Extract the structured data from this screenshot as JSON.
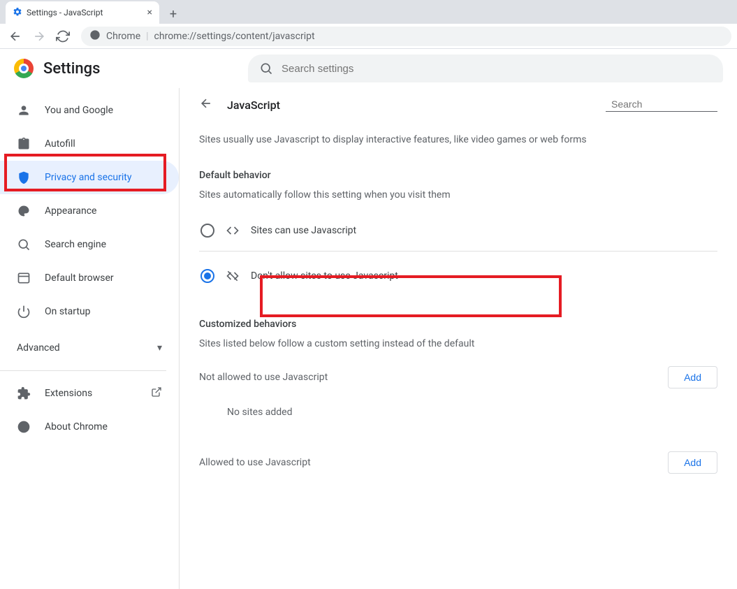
{
  "browser": {
    "tab_title": "Settings - JavaScript",
    "url_label": "Chrome",
    "url_path": "chrome://settings/content/javascript"
  },
  "header": {
    "title": "Settings",
    "search_placeholder": "Search settings"
  },
  "sidebar": {
    "items": [
      {
        "label": "You and Google"
      },
      {
        "label": "Autofill"
      },
      {
        "label": "Privacy and security"
      },
      {
        "label": "Appearance"
      },
      {
        "label": "Search engine"
      },
      {
        "label": "Default browser"
      },
      {
        "label": "On startup"
      }
    ],
    "advanced": "Advanced",
    "extensions": "Extensions",
    "about": "About Chrome"
  },
  "page": {
    "title": "JavaScript",
    "search_placeholder": "Search",
    "description": "Sites usually use Javascript to display interactive features, like video games or web forms",
    "default_behavior_title": "Default behavior",
    "default_behavior_sub": "Sites automatically follow this setting when you visit them",
    "radio_allow": "Sites can use Javascript",
    "radio_block": "Don't allow sites to use Javascript",
    "customized_title": "Customized behaviors",
    "customized_sub": "Sites listed below follow a custom setting instead of the default",
    "not_allowed_title": "Not allowed to use Javascript",
    "allowed_title": "Allowed to use Javascript",
    "add_label": "Add",
    "no_sites": "No sites added"
  }
}
